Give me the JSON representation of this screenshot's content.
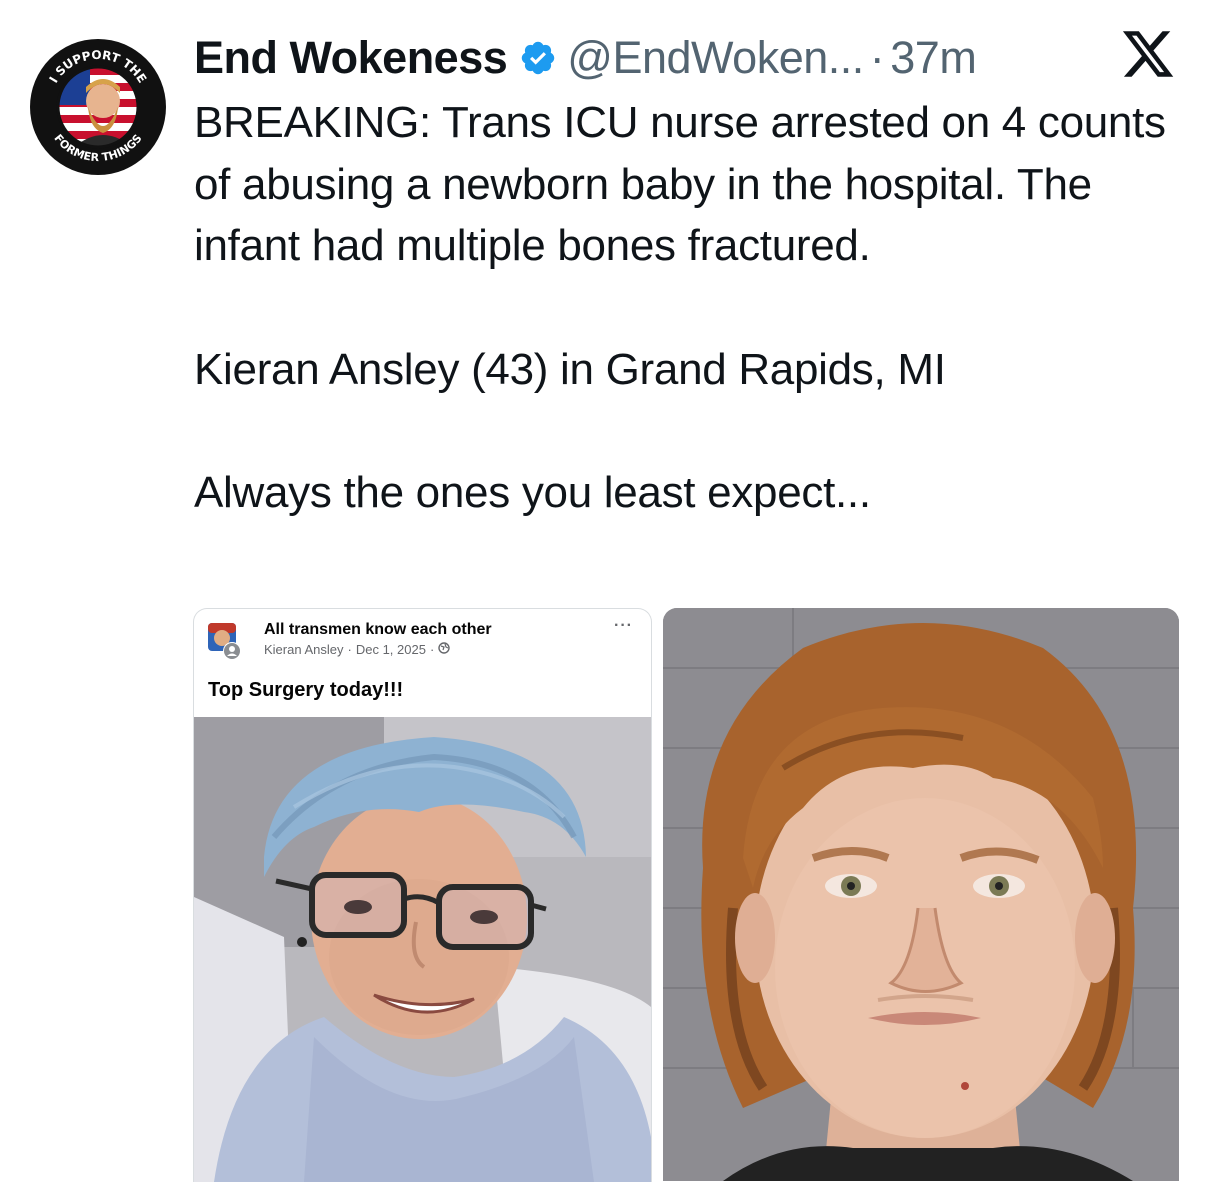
{
  "author": {
    "display_name": "End Wokeness",
    "handle": "@EndWoken...",
    "separator": "·",
    "timestamp": "37m",
    "avatar_top_text": "I SUPPORT THE",
    "avatar_bottom_text": "FORMER THINGS"
  },
  "tweet": {
    "paragraphs": [
      "BREAKING: Trans ICU nurse arrested on 4 counts of abusing a newborn baby in the hospital. The infant had multiple bones fractured.",
      "Kieran Ansley (43) in Grand Rapids, MI",
      "Always the ones you least expect..."
    ]
  },
  "embedded_post": {
    "group_name": "All transmen know each other",
    "author": "Kieran Ansley",
    "dot": "·",
    "date": "Dec 1, 2025",
    "caption": "Top Surgery today!!!",
    "more": "···"
  },
  "icons": {
    "verified": "verified-badge-icon",
    "platform": "x-logo-icon",
    "privacy": "globe-icon"
  },
  "colors": {
    "text": "#0f1419",
    "secondary": "#536471",
    "verified": "#1d9bf0"
  }
}
